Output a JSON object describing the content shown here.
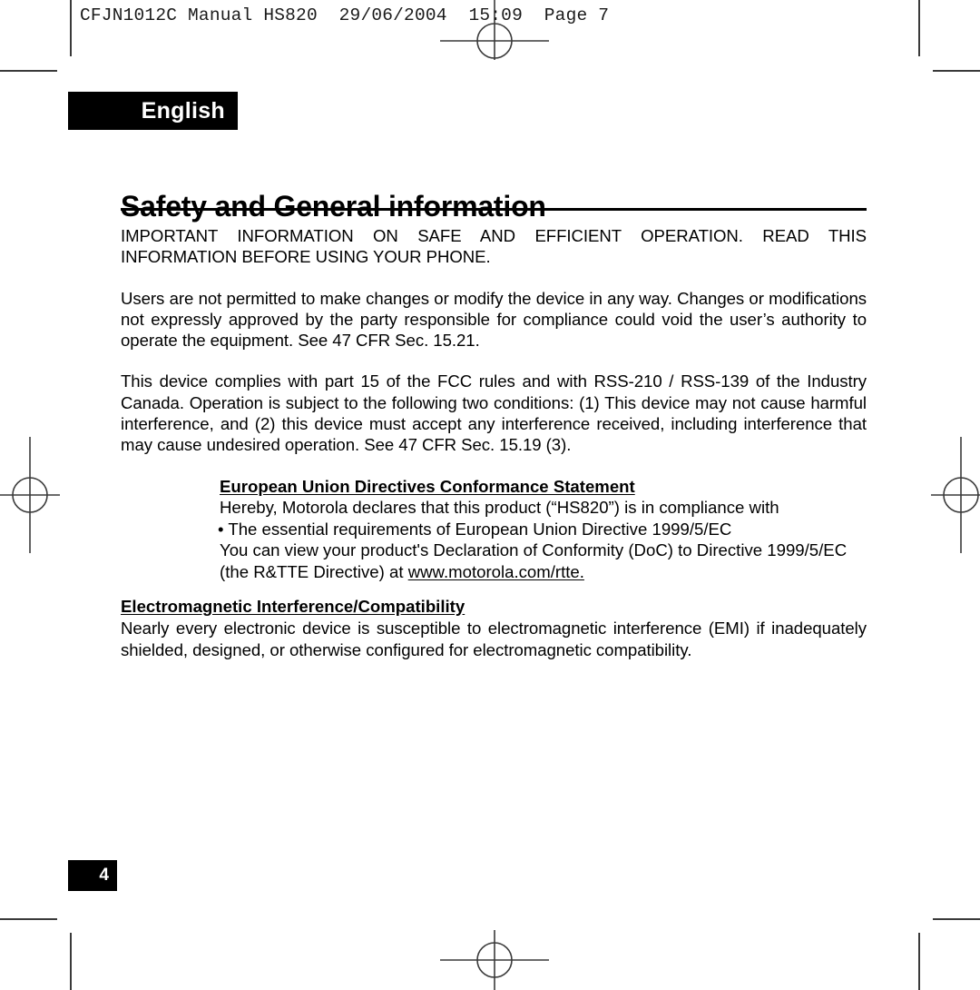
{
  "printer_slug": "CFJN1012C Manual HS820  29/06/2004  15:09  Page 7",
  "language_tab": {
    "label": "English"
  },
  "title": "Safety and General information",
  "paragraphs": {
    "notice": "IMPORTANT INFORMATION ON SAFE AND EFFICIENT OPERATION. READ THIS INFORMATION BEFORE USING YOUR PHONE.",
    "modifications": "Users are not permitted to make changes or modify the device in any way. Changes or modifications not expressly approved by the party responsible for compliance could void the user’s authority to operate the equipment. See 47 CFR Sec. 15.21.",
    "fcc_compliance": "This device complies with part 15 of the FCC rules and with RSS-210 / RSS-139 of the Industry Canada. Operation is subject to the following two conditions: (1) This device may not cause harmful interference, and (2) this device must accept any interference received, including interference that may cause undesired operation. See 47 CFR Sec. 15.19 (3)."
  },
  "eu_section": {
    "heading": "European Union Directives Conformance Statement",
    "line1": "Hereby, Motorola declares that this product (“HS820”) is in compliance with",
    "line2": "• The essential requirements of European Union Directive 1999/5/EC",
    "line3": "You can view your product's Declaration of Conformity (DoC) to Directive 1999/5/EC",
    "line4_prefix": "(the R&TTE Directive) at ",
    "line4_link": "www.motorola.com/rtte."
  },
  "emi_section": {
    "heading": "Electromagnetic Interference/Compatibility",
    "body": "Nearly every electronic device is susceptible to electromagnetic interference (EMI) if inadequately shielded, designed, or otherwise configured for electromagnetic compatibility."
  },
  "page_number": "4",
  "colors": {
    "ink": "#000000",
    "paper": "#ffffff",
    "crop_mark": "#3a3a3a"
  }
}
